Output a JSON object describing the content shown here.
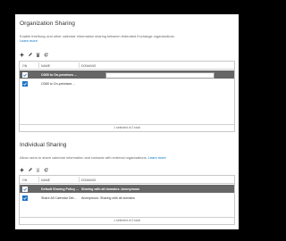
{
  "org": {
    "title": "Organization Sharing",
    "description": "Enable free/busy and other calendar information sharing between federated Exchange organizations.",
    "learn_more": "Learn more",
    "columns": [
      "ON",
      "NAME",
      "DOMAINS"
    ],
    "rows": [
      {
        "name": "O365 to On-premises ...",
        "domains": ""
      },
      {
        "name": "O365 to On-premises ...",
        "domains": ""
      }
    ],
    "footer": "1 selected of 2 total"
  },
  "individual": {
    "title": "Individual Sharing",
    "description": "Allow users to share calendar information and contacts with external organizations.",
    "learn_more": "Learn more",
    "columns": [
      "ON",
      "NAME",
      "DOMAINS"
    ],
    "rows": [
      {
        "name": "Default Sharing Policy ...",
        "domains": "Sharing with all domains: Anonymous"
      },
      {
        "name": "Share All Calendar Det...",
        "domains": "Anonymous: Sharing with all domains"
      }
    ],
    "footer": "1 selected of 2 total"
  },
  "icons": [
    "add-icon",
    "edit-icon",
    "delete-icon",
    "refresh-icon"
  ],
  "colors": {
    "accent": "#0072c6",
    "selected_row": "#666666",
    "checkbox": "#1e73c6"
  }
}
